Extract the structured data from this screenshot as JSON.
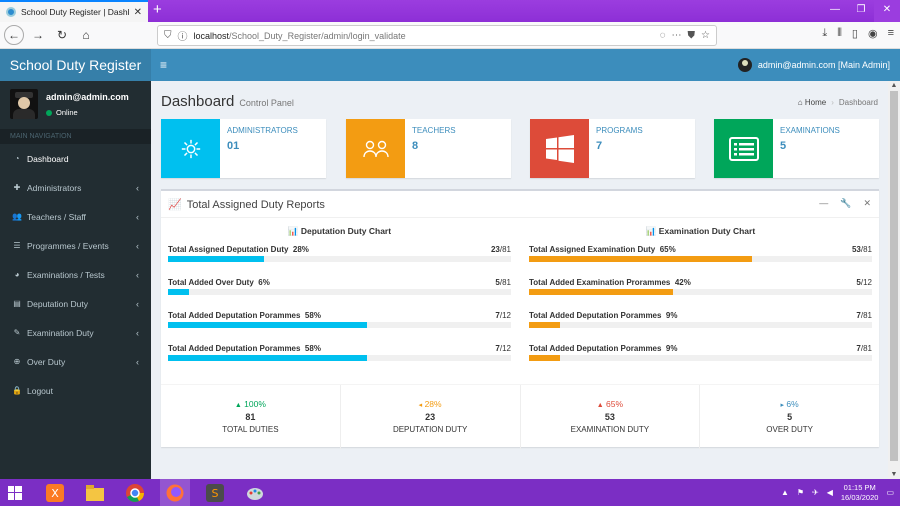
{
  "browser": {
    "tab_title": "School Duty Register | Dashboa",
    "url_host": "localhost",
    "url_path": "/School_Duty_Register/admin/login_validate"
  },
  "app": {
    "logo": "School Duty Register",
    "user_menu": "admin@admin.com [Main Admin]"
  },
  "sidebar": {
    "user_name": "admin@admin.com",
    "status": "Online",
    "header": "MAIN NAVIGATION",
    "items": [
      {
        "label": "Dashboard",
        "icon": "dashboard-icon"
      },
      {
        "label": "Administrators",
        "icon": "user-plus-icon"
      },
      {
        "label": "Teachers / Staff",
        "icon": "users-icon"
      },
      {
        "label": "Programmes / Events",
        "icon": "list-icon"
      },
      {
        "label": "Examinations / Tests",
        "icon": "pie-chart-icon"
      },
      {
        "label": "Deputation Duty",
        "icon": "table-icon"
      },
      {
        "label": "Examination Duty",
        "icon": "edit-icon"
      },
      {
        "label": "Over Duty",
        "icon": "plus-circle-icon"
      },
      {
        "label": "Logout",
        "icon": "lock-icon"
      }
    ]
  },
  "page": {
    "title": "Dashboard",
    "subtitle": "Control Panel",
    "breadcrumb_home": "Home",
    "breadcrumb_current": "Dashboard"
  },
  "info_boxes": [
    {
      "label": "ADMINISTRATORS",
      "value": "01",
      "color": "#00c0ef",
      "icon": "gear-icon"
    },
    {
      "label": "TEACHERS",
      "value": "8",
      "color": "#f39c12",
      "icon": "teachers-icon"
    },
    {
      "label": "PROGRAMS",
      "value": "7",
      "color": "#dd4b39",
      "icon": "windows-icon"
    },
    {
      "label": "EXAMINATIONS",
      "value": "5",
      "color": "#00a65a",
      "icon": "list-alt-icon"
    }
  ],
  "report": {
    "title": "Total Assigned Duty Reports",
    "left": {
      "title": "Deputation Duty Chart",
      "color": "#00c0ef",
      "rows": [
        {
          "label": "Total Assigned Deputation Duty",
          "pct": "28%",
          "done": "23",
          "total": "/81",
          "fraction": 0.28
        },
        {
          "label": "Total Added Over Duty",
          "pct": "6%",
          "done": "5",
          "total": "/81",
          "fraction": 0.06
        },
        {
          "label": "Total Added Deputation Porammes",
          "pct": "58%",
          "done": "7",
          "total": "/12",
          "fraction": 0.58
        },
        {
          "label": "Total Added Deputation Porammes",
          "pct": "58%",
          "done": "7",
          "total": "/12",
          "fraction": 0.58
        }
      ]
    },
    "right": {
      "title": "Examination Duty Chart",
      "color": "#f39c12",
      "rows": [
        {
          "label": "Total Assigned Examination Duty",
          "pct": "65%",
          "done": "53",
          "total": "/81",
          "fraction": 0.65
        },
        {
          "label": "Total Added Examination Prorammes",
          "pct": "42%",
          "done": "5",
          "total": "/12",
          "fraction": 0.42
        },
        {
          "label": "Total Added Deputation Porammes",
          "pct": "9%",
          "done": "7",
          "total": "/81",
          "fraction": 0.09
        },
        {
          "label": "Total Added Deputation Porammes",
          "pct": "9%",
          "done": "7",
          "total": "/81",
          "fraction": 0.09
        }
      ]
    },
    "footer": [
      {
        "pct": "100%",
        "num": "81",
        "label": "TOTAL DUTIES",
        "color": "#00a65a",
        "arrow": "▲"
      },
      {
        "pct": "28%",
        "num": "23",
        "label": "DEPUTATION DUTY",
        "color": "#f39c12",
        "arrow": "◂"
      },
      {
        "pct": "65%",
        "num": "53",
        "label": "EXAMINATION DUTY",
        "color": "#dd4b39",
        "arrow": "▲"
      },
      {
        "pct": "6%",
        "num": "5",
        "label": "OVER DUTY",
        "color": "#3c8dbc",
        "arrow": "▸"
      }
    ]
  },
  "taskbar": {
    "time": "01:15 PM",
    "date": "16/03/2020"
  }
}
